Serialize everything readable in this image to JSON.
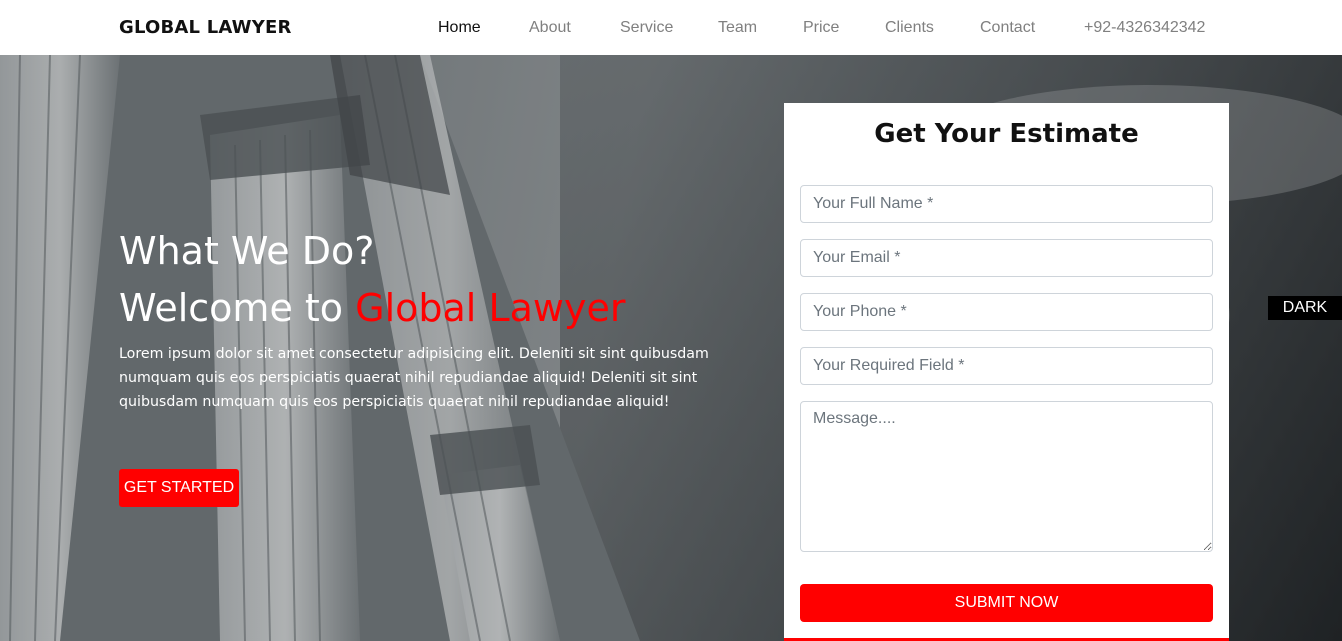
{
  "brand": "GLOBAL LAWYER",
  "nav": {
    "items": [
      "Home",
      "About",
      "Service",
      "Team",
      "Price",
      "Clients",
      "Contact"
    ],
    "phone": "+92-4326342342"
  },
  "hero": {
    "line1": "What We Do?",
    "line2_prefix": "Welcome to ",
    "line2_accent": "Global Lawyer",
    "paragraph": "Lorem ipsum dolor sit amet consectetur adipisicing elit. Deleniti sit sint quibusdam numquam quis eos perspiciatis quaerat nihil repudiandae aliquid! Deleniti sit sint quibusdam numquam quis eos perspiciatis quaerat nihil repudiandae aliquid!",
    "cta": "GET STARTED"
  },
  "form": {
    "title": "Get Your Estimate",
    "name_placeholder": "Your Full Name *",
    "email_placeholder": "Your Email *",
    "phone_placeholder": "Your Phone *",
    "required_placeholder": "Your Required Field *",
    "message_placeholder": "Message....",
    "submit": "SUBMIT NOW"
  },
  "dark_toggle": "DARK",
  "colors": {
    "accent": "#ff0000",
    "text_dark": "#111111",
    "nav_inactive": "#808080"
  }
}
